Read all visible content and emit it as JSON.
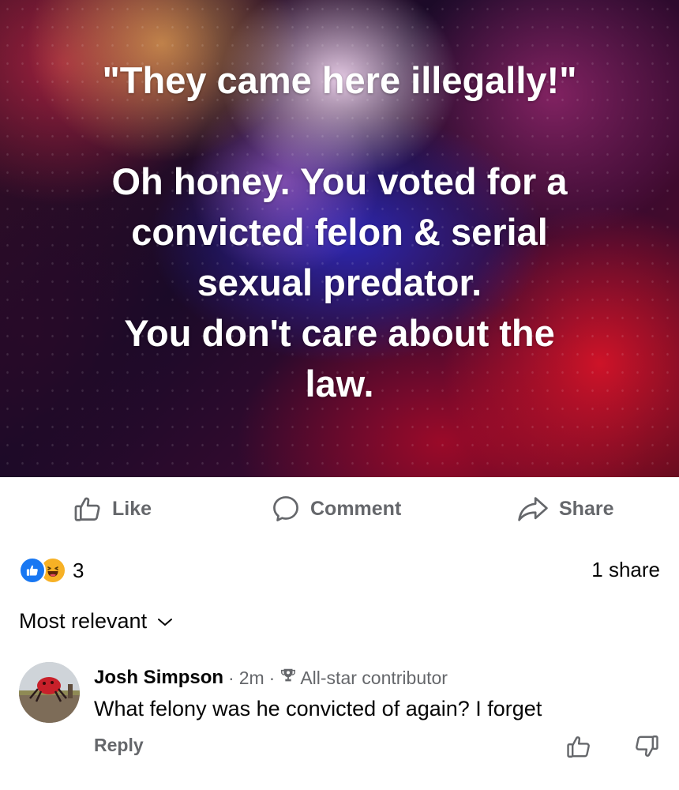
{
  "post": {
    "image_text": {
      "quote": "\"They came here illegally!\"",
      "line1": "Oh honey. You voted for a",
      "line2": "convicted felon & serial",
      "line3": "sexual predator.",
      "line4": "You don't care about the",
      "line5": "law."
    }
  },
  "actions": {
    "like": "Like",
    "comment": "Comment",
    "share": "Share"
  },
  "stats": {
    "reaction_count": "3",
    "shares": "1 share"
  },
  "reaction_types": [
    "like-icon",
    "haha-icon"
  ],
  "sort": {
    "label": "Most relevant"
  },
  "comments": [
    {
      "author": "Josh Simpson",
      "time": "2m",
      "badge": "All-star contributor",
      "text": "What felony was he convicted of again? I forget",
      "reply_label": "Reply"
    }
  ],
  "colors": {
    "brand_blue": "#1877f2",
    "secondary_text": "#65676b",
    "primary_text": "#050505",
    "haha_yellow": "#f7b125"
  }
}
